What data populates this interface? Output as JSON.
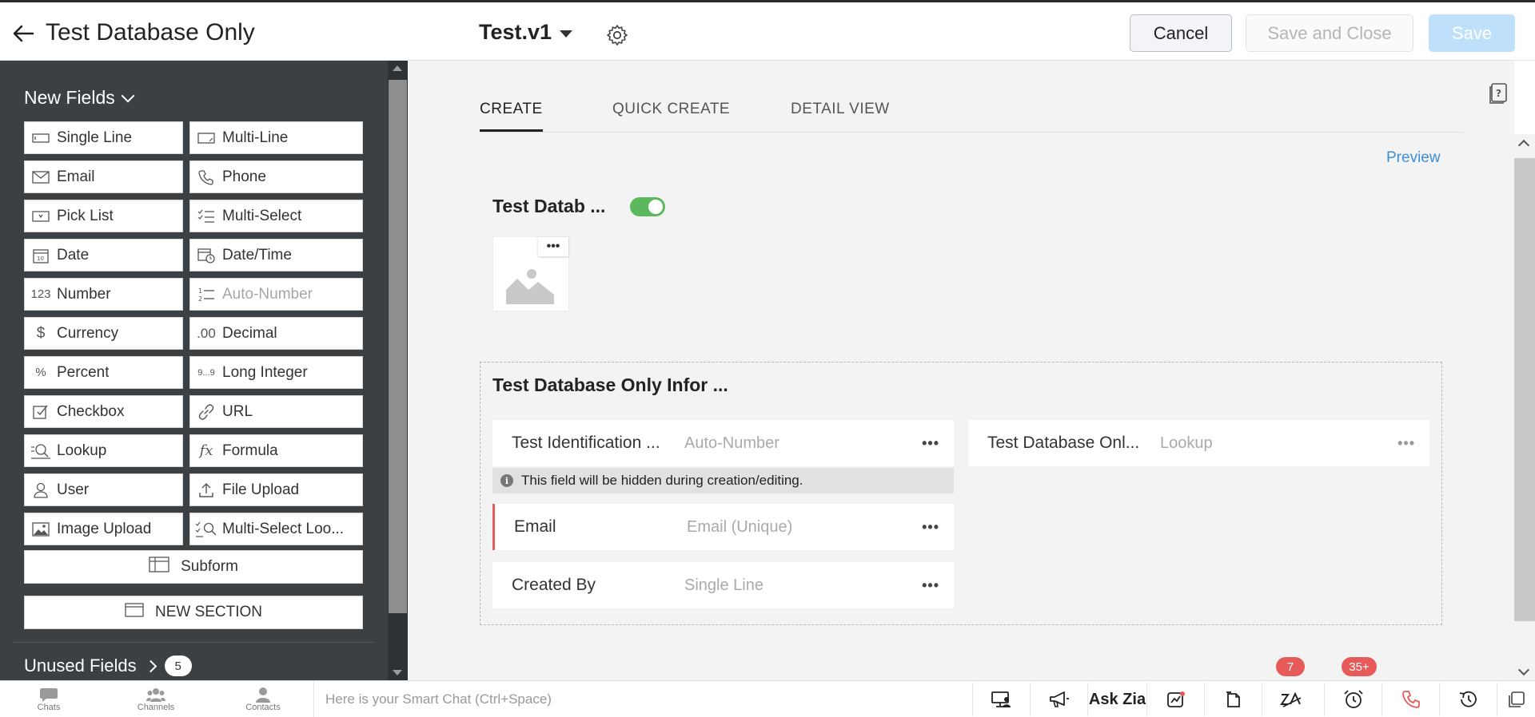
{
  "header": {
    "title": "Test Database Only",
    "layout_name": "Test.v1",
    "cancel_label": "Cancel",
    "save_close_label": "Save and Close",
    "save_label": "Save"
  },
  "palette": {
    "new_fields_label": "New Fields",
    "fields": [
      {
        "label": "Single Line",
        "icon": "single-line-icon"
      },
      {
        "label": "Multi-Line",
        "icon": "multi-line-icon"
      },
      {
        "label": "Email",
        "icon": "email-icon"
      },
      {
        "label": "Phone",
        "icon": "phone-icon"
      },
      {
        "label": "Pick List",
        "icon": "picklist-icon"
      },
      {
        "label": "Multi-Select",
        "icon": "multi-select-icon"
      },
      {
        "label": "Date",
        "icon": "date-icon"
      },
      {
        "label": "Date/Time",
        "icon": "datetime-icon"
      },
      {
        "label": "Number",
        "icon": "number-icon",
        "glyph": "123"
      },
      {
        "label": "Auto-Number",
        "icon": "auto-number-icon",
        "disabled": true
      },
      {
        "label": "Currency",
        "icon": "currency-icon",
        "glyph": "$"
      },
      {
        "label": "Decimal",
        "icon": "decimal-icon",
        "glyph": ".00"
      },
      {
        "label": "Percent",
        "icon": "percent-icon",
        "glyph": "%"
      },
      {
        "label": "Long Integer",
        "icon": "long-integer-icon",
        "glyph": "9...9"
      },
      {
        "label": "Checkbox",
        "icon": "checkbox-icon"
      },
      {
        "label": "URL",
        "icon": "url-icon"
      },
      {
        "label": "Lookup",
        "icon": "lookup-icon"
      },
      {
        "label": "Formula",
        "icon": "formula-icon",
        "glyph": "fx"
      },
      {
        "label": "User",
        "icon": "user-icon"
      },
      {
        "label": "File Upload",
        "icon": "file-upload-icon"
      },
      {
        "label": "Image Upload",
        "icon": "image-upload-icon"
      },
      {
        "label": "Multi-Select Loo...",
        "icon": "multi-select-lookup-icon"
      }
    ],
    "subform_label": "Subform",
    "new_section_label": "NEW SECTION",
    "unused_fields_label": "Unused Fields",
    "unused_count": "5"
  },
  "canvas": {
    "tabs": [
      "CREATE",
      "QUICK CREATE",
      "DETAIL VIEW"
    ],
    "active_tab": 0,
    "preview_label": "Preview",
    "module_name": "Test Datab ...",
    "toggle_on": true,
    "section_title": "Test Database Only Infor ...",
    "fields": [
      {
        "label": "Test Identification ...",
        "type": "Auto-Number"
      },
      {
        "label": "Test Database Onl...",
        "type": "Lookup"
      },
      {
        "label": "Email",
        "type": "Email (Unique)",
        "required": true
      },
      {
        "label": "Created By",
        "type": "Single Line"
      }
    ],
    "hidden_note": "This field will be hidden during creation/editing."
  },
  "bottombar": {
    "chats_label": "Chats",
    "channels_label": "Channels",
    "contacts_label": "Contacts",
    "smart_chat_placeholder": "Here is your Smart Chat (Ctrl+Space)",
    "ask_zia_label": "Ask Zia",
    "zia_badge": "7",
    "reminder_badge": "35+"
  },
  "colors": {
    "palette_bg": "#3c4043",
    "accent_link": "#3b8fd9",
    "toggle_on": "#5cb85c",
    "required_marker": "#e25c5c",
    "badge": "#e65a5a",
    "save_disabled": "#bfe0fa"
  }
}
